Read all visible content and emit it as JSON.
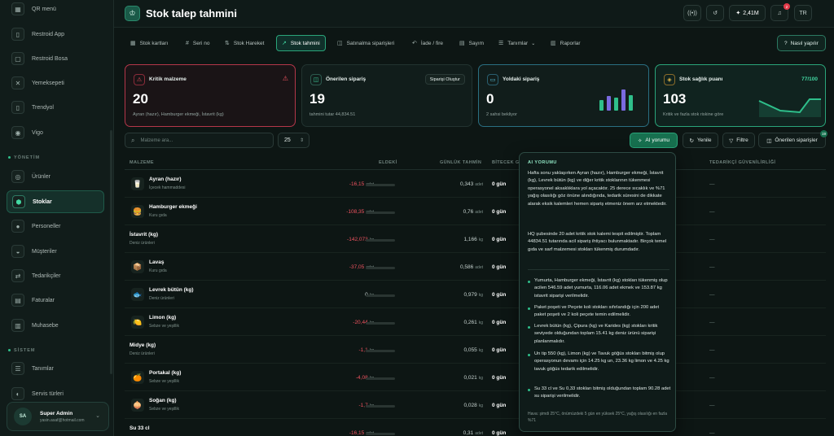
{
  "sidebar": {
    "items": [
      {
        "label": "QR menü",
        "icon": "qr-icon",
        "glyph": "▦"
      },
      {
        "label": "Restroid App",
        "icon": "phone-icon",
        "glyph": "▯"
      },
      {
        "label": "Restroid Bosa",
        "icon": "device-icon",
        "glyph": "▢"
      },
      {
        "label": "Yemeksepeti",
        "icon": "cutlery-icon",
        "glyph": "✕"
      },
      {
        "label": "Trendyol",
        "icon": "tablet-icon",
        "glyph": "▯"
      },
      {
        "label": "Vigo",
        "icon": "pin-icon",
        "glyph": "◉"
      },
      {
        "label": "Ürünler",
        "icon": "box-icon",
        "glyph": "◎"
      },
      {
        "label": "Stoklar",
        "icon": "stock-icon",
        "glyph": "⬢"
      },
      {
        "label": "Personeller",
        "icon": "user-icon",
        "glyph": "●"
      },
      {
        "label": "Müşteriler",
        "icon": "users-icon",
        "glyph": "◒"
      },
      {
        "label": "Tedarikçiler",
        "icon": "supplier-icon",
        "glyph": "⇄"
      },
      {
        "label": "Faturalar",
        "icon": "invoice-icon",
        "glyph": "▤"
      },
      {
        "label": "Muhasebe",
        "icon": "ledger-icon",
        "glyph": "▥"
      },
      {
        "label": "Tanımlar",
        "icon": "list-icon",
        "glyph": "☰"
      },
      {
        "label": "Servis türleri",
        "icon": "service-icon",
        "glyph": "◐"
      }
    ],
    "sections": {
      "management": "YÖNETİM",
      "system": "SİSTEM"
    },
    "user": {
      "initials": "SA",
      "name": "Super Admin",
      "email": "yasin.asaf@hotmail.com"
    }
  },
  "header": {
    "title": "Stok talep tahmini",
    "logo": "chef-hat-icon",
    "logo_glyph": "♔",
    "ai_credit": "2,41M",
    "notif_count": "2",
    "lang": "TR"
  },
  "tabs": [
    {
      "label": "Stok kartları",
      "glyph": "▦"
    },
    {
      "label": "Seri no",
      "glyph": "#"
    },
    {
      "label": "Stok Hareket",
      "glyph": "⇅"
    },
    {
      "label": "Stok tahmini",
      "glyph": "↗"
    },
    {
      "label": "Satınalma siparişleri",
      "glyph": "◫"
    },
    {
      "label": "İade / fire",
      "glyph": "↶"
    },
    {
      "label": "Sayım",
      "glyph": "▤"
    },
    {
      "label": "Tanımlar",
      "glyph": "☰"
    },
    {
      "label": "Raporlar",
      "glyph": "▥"
    }
  ],
  "help_label": "Nasıl yapılır",
  "cards": {
    "critical": {
      "title": "Kritik malzeme",
      "value": "20",
      "sub": "Ayran (hazır), Hamburger ekmeği, İstavrit (kg)"
    },
    "recommended": {
      "title": "Önerilen sipariş",
      "value": "19",
      "sub": "tahmini tutar 44,834.51",
      "action": "Siparişi Oluştur"
    },
    "pending": {
      "title": "Yoldaki sipariş",
      "value": "0",
      "sub": "2 sahsi bekliyor",
      "bars": [
        0.5,
        0.7,
        0.6,
        1.0,
        0.75
      ]
    },
    "health": {
      "title": "Stok sağlık puanı",
      "value": "103",
      "score": "77/100",
      "sub": "Kritik ve fazla stok riskine göre"
    }
  },
  "search": {
    "placeholder": "Malzeme ara..."
  },
  "page_size": "25",
  "actions": {
    "ai": "AI yorumu",
    "refresh": "Yenile",
    "filter": "Filtre",
    "orders": "Önerilen siparişler",
    "orders_count": "19"
  },
  "table": {
    "headers": [
      "MALZEME",
      "ELDEKİ",
      "GÜNLÜK TAHMİN",
      "BİTECEK GÜN",
      "TEDARİKÇİ GÜVENİLİRLİĞİ"
    ],
    "rows": [
      {
        "name": "Ayran (hazır)",
        "cat": "İçecek hammaddesi",
        "stock": "-16,15",
        "unit": "adet",
        "daily": "0,343",
        "dunit": "adet",
        "days": "0 gün",
        "glyph": "🥛"
      },
      {
        "name": "Hamburger ekmeği",
        "cat": "Kuru gıda",
        "stock": "-108,35",
        "unit": "adet",
        "daily": "0,76",
        "dunit": "adet",
        "days": "0 gün",
        "glyph": "🍔"
      },
      {
        "name": "İstavrit (kg)",
        "cat": "Deniz ürünleri",
        "stock": "-142,073",
        "unit": "kg",
        "daily": "1,166",
        "dunit": "kg",
        "days": "0 gün",
        "glyph": ""
      },
      {
        "name": "Lavaş",
        "cat": "Kuru gıda",
        "stock": "-37,05",
        "unit": "adet",
        "daily": "0,586",
        "dunit": "adet",
        "days": "0 gün",
        "glyph": "📦"
      },
      {
        "name": "Levrek bütün (kg)",
        "cat": "Deniz ürünleri",
        "stock": "0",
        "unit": "kg",
        "daily": "0,979",
        "dunit": "kg",
        "days": "0 gün",
        "glyph": "🐟"
      },
      {
        "name": "Limon (kg)",
        "cat": "Sebze ve yeşillik",
        "stock": "-20,44",
        "unit": "kg",
        "daily": "0,261",
        "dunit": "kg",
        "days": "0 gün",
        "glyph": "🍋"
      },
      {
        "name": "Midye (kg)",
        "cat": "Deniz ürünleri",
        "stock": "-1,1",
        "unit": "kg",
        "daily": "0,055",
        "dunit": "kg",
        "days": "0 gün",
        "glyph": ""
      },
      {
        "name": "Portakal (kg)",
        "cat": "Sebze ve yeşillik",
        "stock": "-4,08",
        "unit": "kg",
        "daily": "0,021",
        "dunit": "kg",
        "days": "0 gün",
        "glyph": "🍊"
      },
      {
        "name": "Soğan (kg)",
        "cat": "Sebze ve yeşillik",
        "stock": "-1,7",
        "unit": "kg",
        "daily": "0,028",
        "dunit": "kg",
        "days": "0 gün",
        "glyph": "🧅"
      },
      {
        "name": "Su 33 cl",
        "cat": "",
        "stock": "-16,15",
        "unit": "adet",
        "daily": "0,31",
        "dunit": "adet",
        "days": "0 gün",
        "glyph": ""
      }
    ]
  },
  "ai": {
    "heading": "AI YORUMU",
    "p1": "Hafta sonu yaklaşırken Ayran (hazır), Hamburger ekmeği, İstavrit (kg), Levrek bütün (kg) ve diğer kritik stoklarının tükenmesi operasyonel aksaklıklara yol açacaktır. 25 derece sıcaklık ve %71 yağış olasılığı göz önüne alındığında, tedarik süresini de dikkate alarak eksik kalemleri hemen sipariş etmeniz önem arz etmektedir.",
    "p2": "HQ şubesinde 20 adet kritik stok kalemi tespit edilmiştir. Toplam 44834.51 tutarında acil sipariş ihtiyacı bulunmaktadır. Birçok temel gıda ve sarf malzemesi stokları tükenmiş durumdadır.",
    "bullets": [
      "Yumurta, Hamburger ekmeği, İstavrit (kg) stokları tükenmiş olup acilen 546.59 adet yumurta, 116.06 adet ekmek ve 153.87 kg istavrit siparişi verilmelidir.",
      "Paket poşeti ve Peçete koli stokları sıfırlandığı için 200 adet paket poşeti ve 2 koli peçete temin edilmelidir.",
      "Levrek bütün (kg), Çipura (kg) ve Karides (kg) stokları kritik seviyede olduğundan toplam 15.41 kg deniz ürünü siparişi planlanmalıdır.",
      "Un tip 550 (kg), Limon (kg) ve Tavuk göğüs stokları bitmiş olup operasyonun devamı için 14.25 kg un, 23.36 kg limon ve 4.25 kg tavuk göğüs tedarik edilmelidir.",
      "Su 33 cl ve Su 0,33 stokları bitmiş olduğundan toplam 90.28 adet su siparişi verilmelidir."
    ],
    "footer": "Hava: şimdi 25°C, önümüzdeki 5 gün en yüksek 25°C, yağış olasılığı en fazla %71"
  },
  "colors": {
    "accent": "#2fbf8b",
    "critical": "#e0465a",
    "primary": "#17704f"
  }
}
